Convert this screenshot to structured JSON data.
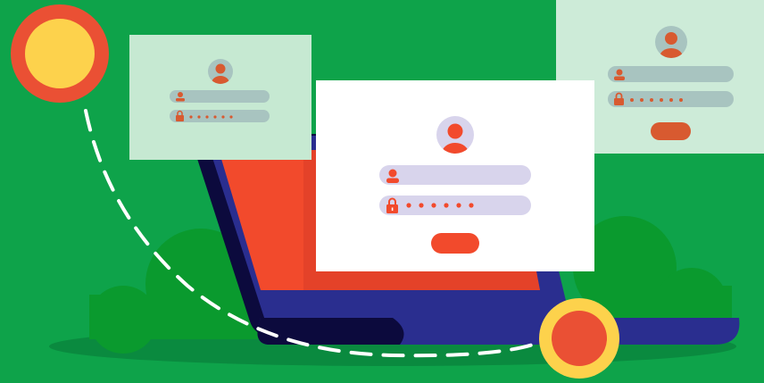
{
  "illustration": {
    "colors": {
      "background": "#0ea34a",
      "ground_shadow": "#0a8a3f",
      "bush": "#0a9a2e",
      "laptop_body": "#2a2e8f",
      "laptop_dark": "#0c0a3d",
      "laptop_screen": "#f24a2c",
      "accent_red": "#ea5034",
      "accent_yellow": "#fdd24c",
      "field_fill_front": "#d8d4ec",
      "field_fill_back": "#a8c4c0",
      "button_front": "#f24a2c",
      "button_back": "#d85a30",
      "path_dashes": "#ffffff"
    },
    "cards": [
      {
        "name": "front-login-card",
        "password_mask": "● ● ● ● ● ●",
        "user_icon": "user-icon",
        "lock_icon": "lock-icon"
      },
      {
        "name": "left-login-card",
        "password_mask": "● ● ● ● ● ●",
        "user_icon": "user-icon",
        "lock_icon": "lock-icon"
      },
      {
        "name": "right-login-card",
        "password_mask": "● ● ● ● ● ●",
        "user_icon": "user-icon",
        "lock_icon": "lock-icon"
      }
    ],
    "icons": [
      "avatar-icon",
      "user-icon",
      "lock-icon",
      "laptop-icon",
      "circle-marker-icon"
    ]
  }
}
